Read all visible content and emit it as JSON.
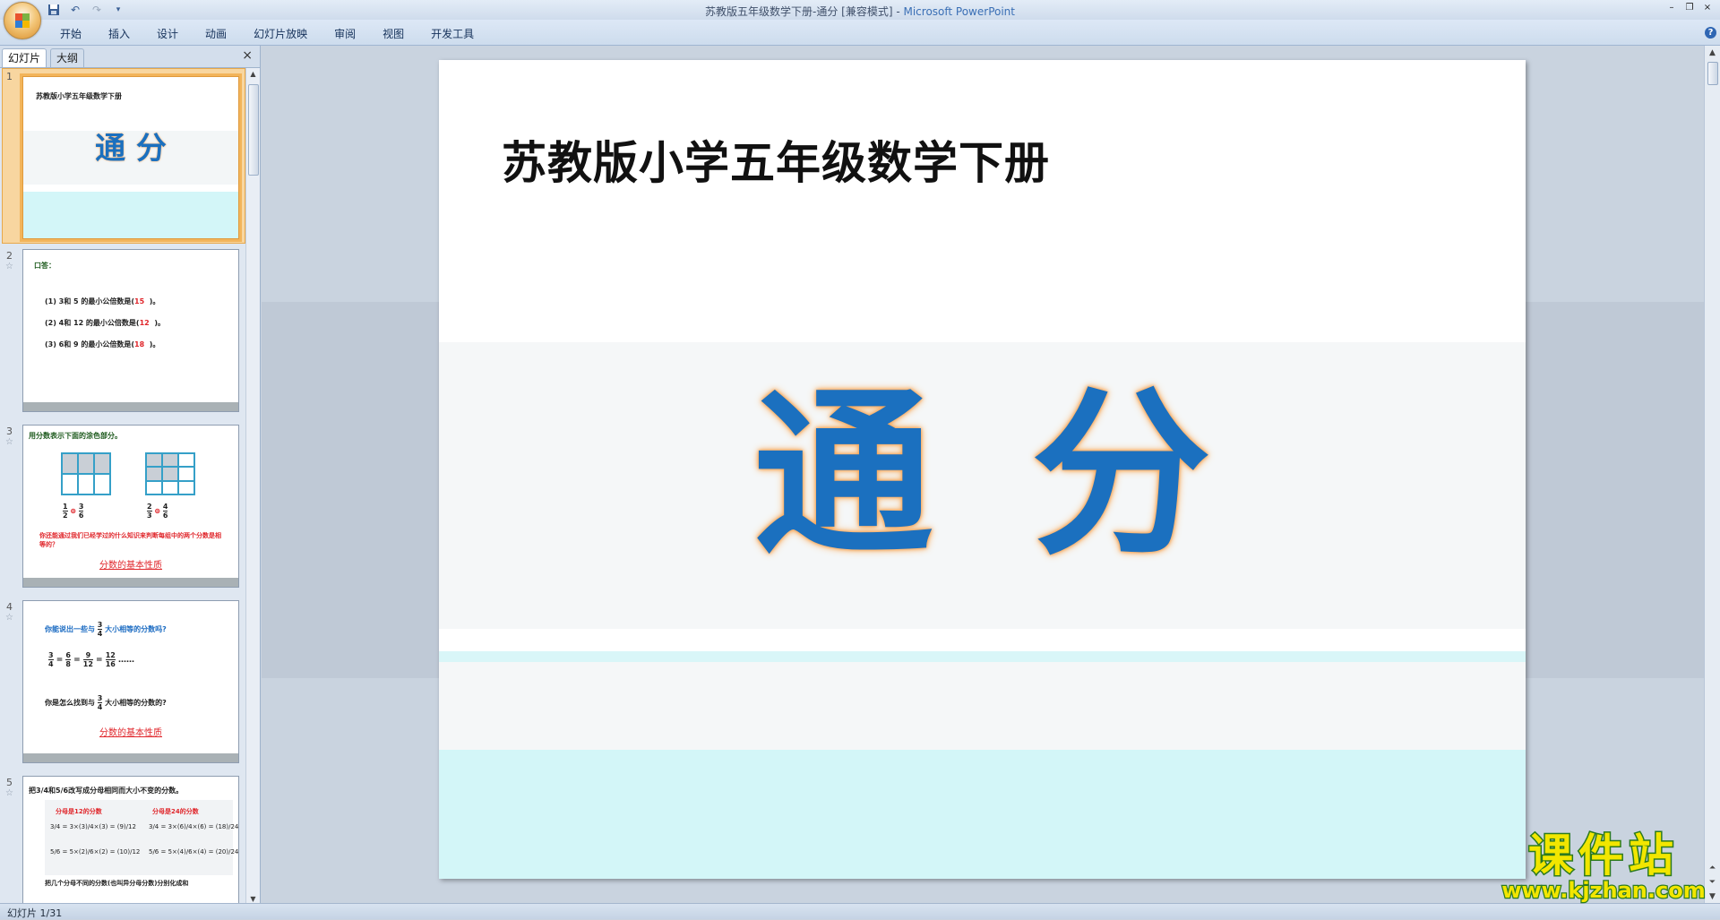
{
  "window": {
    "title_main": "苏教版五年级数学下册-通分 [兼容模式] - ",
    "title_brand": "Microsoft PowerPoint",
    "controls": [
      "–",
      "❐",
      "×"
    ]
  },
  "qat": [
    "save-icon",
    "undo-icon",
    "redo-icon",
    "customize-icon"
  ],
  "ribbon": {
    "tabs": [
      "开始",
      "插入",
      "设计",
      "动画",
      "幻灯片放映",
      "审阅",
      "视图",
      "开发工具"
    ],
    "help": "?"
  },
  "left_pane": {
    "tab_slides": "幻灯片",
    "tab_outline": "大纲",
    "close": "×",
    "thumbnails": [
      {
        "num": "1",
        "title": "苏教版小学五年级数学下册",
        "big": "通 分"
      },
      {
        "num": "2",
        "heading": "口答：",
        "lines": [
          {
            "text": "(1) 3和 5 的最小公倍数是(",
            "answer": "15",
            "end": ")。"
          },
          {
            "text": "(2) 4和 12 的最小公倍数是(",
            "answer": "12",
            "end": ")。"
          },
          {
            "text": "(3) 6和 9 的最小公倍数是(",
            "answer": "18",
            "end": ")。"
          }
        ]
      },
      {
        "num": "3",
        "heading": "用分数表示下面的涂色部分。",
        "frac_left": [
          "1",
          "2",
          "3",
          "6"
        ],
        "frac_right": [
          "2",
          "3",
          "4",
          "6"
        ],
        "question": "你还能通过我们已经学过的什么知识来判断每组中的两个分数是相等的？",
        "answer": "分数的基本性质"
      },
      {
        "num": "4",
        "q1a": "你能说出一些与",
        "q1b": "大小相等的分数吗?",
        "frac": [
          "3",
          "4"
        ],
        "chain": [
          "6",
          "8",
          "9",
          "12",
          "12",
          "16"
        ],
        "dots": "……",
        "q2a": "你是怎么找到与",
        "q2b": "大小相等的分数的?",
        "answer": "分数的基本性质"
      },
      {
        "num": "5",
        "heading": "把3/4和5/6改写成分母相同而大小不变的分数。",
        "col1": "分母是12的分数",
        "col2": "分母是24的分数",
        "footer": "把几个分母不同的分数(也叫异分母分数)分别化成和"
      }
    ]
  },
  "slide": {
    "title": "苏教版小学五年级数学下册",
    "big_text": "通分"
  },
  "status": {
    "slide_indicator": "幻灯片 1/31"
  },
  "watermark": {
    "line1": "课件站",
    "line2": "www.kjzhan.com"
  },
  "colors": {
    "accent_blue": "#1b70bf",
    "answer_red": "#e0262b",
    "selection_orange": "#f2b45a"
  }
}
